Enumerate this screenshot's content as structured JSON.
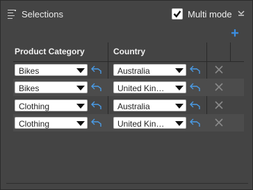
{
  "header": {
    "title": "Selections",
    "multi_mode_label": "Multi mode",
    "multi_mode_checked": true
  },
  "columns": [
    "Product Category",
    "Country"
  ],
  "rows": [
    {
      "category": "Bikes",
      "country": "Australia"
    },
    {
      "category": "Bikes",
      "country": "United Kin…"
    },
    {
      "category": "Clothing",
      "country": "Australia"
    },
    {
      "category": "Clothing",
      "country": "United Kin…"
    }
  ],
  "colors": {
    "accent": "#3b8fe4",
    "panel": "#444444",
    "field": "#ffffff"
  },
  "icons": {
    "menu": "menu-icon",
    "collapse": "collapse-icon",
    "add": "add-icon",
    "link": "link-arrow-icon",
    "delete": "delete-icon",
    "dropdown": "chevron-down-icon"
  }
}
